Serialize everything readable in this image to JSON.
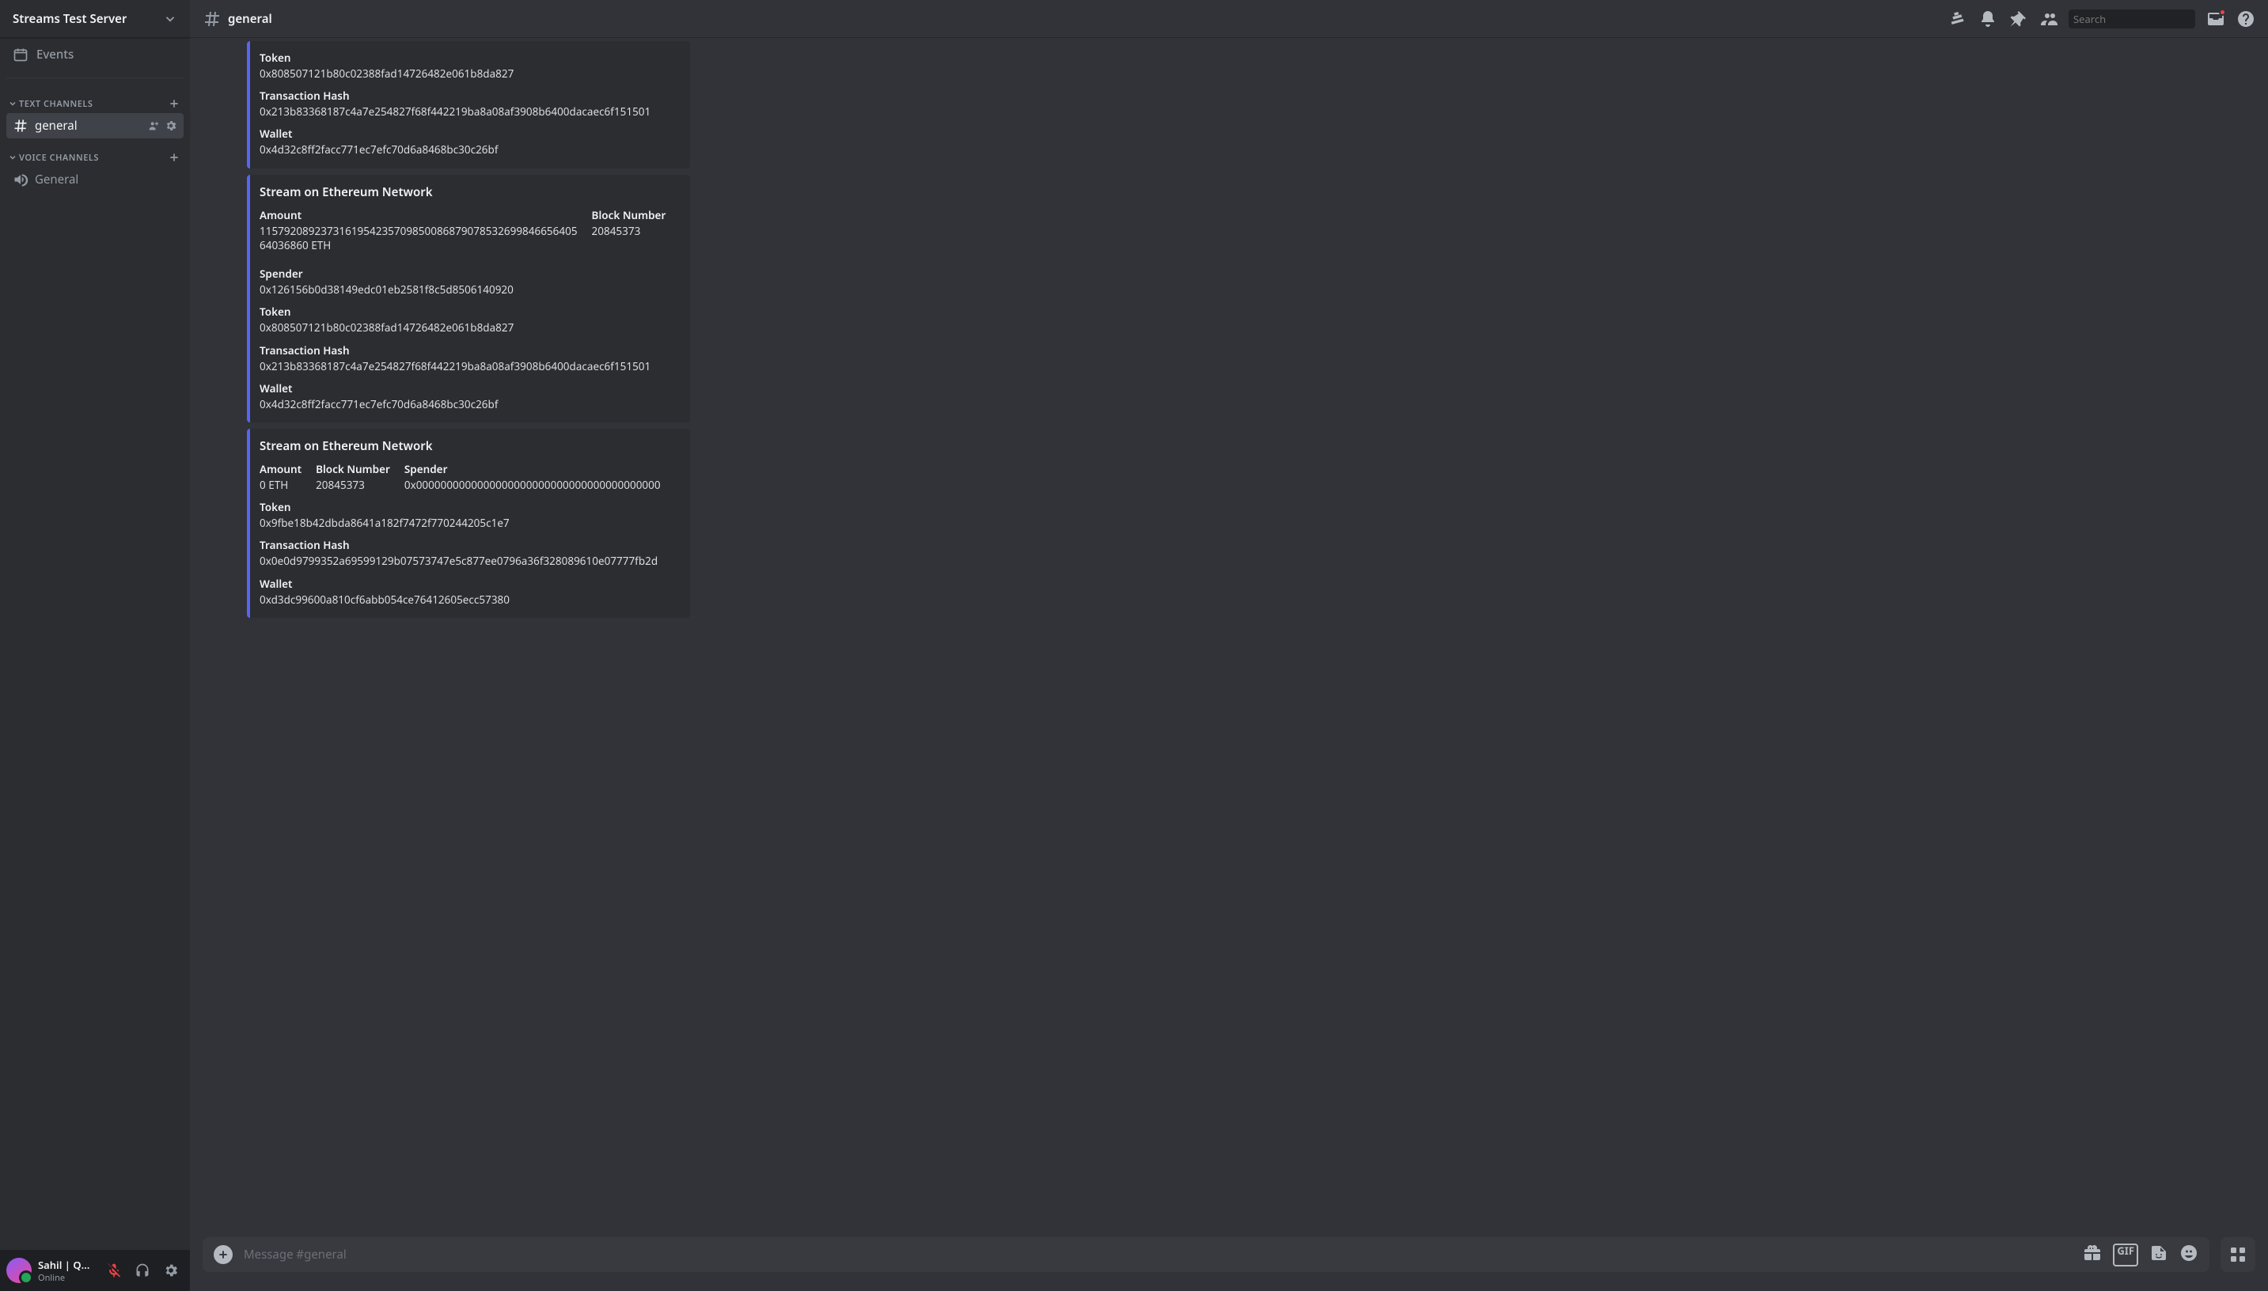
{
  "server": {
    "name": "Streams Test Server"
  },
  "sidebar": {
    "events_label": "Events",
    "text_channels_label": "TEXT CHANNELS",
    "voice_channels_label": "VOICE CHANNELS",
    "text_channels": [
      {
        "name": "general",
        "active": true
      }
    ],
    "voice_channels": [
      {
        "name": "General"
      }
    ]
  },
  "user": {
    "name": "Sahil | Qui...",
    "status": "Online"
  },
  "topbar": {
    "channel_name": "general",
    "search_placeholder": "Search"
  },
  "embeds": [
    {
      "partial": true,
      "fields_full": [
        {
          "name": "Token",
          "value": "0x808507121b80c02388fad14726482e061b8da827"
        },
        {
          "name": "Transaction Hash",
          "value": "0x213b83368187c4a7e254827f68f442219ba8a08af3908b6400dacaec6f151501"
        },
        {
          "name": "Wallet",
          "value": "0x4d32c8ff2facc771ec7efc70d6a8468bc30c26bf"
        }
      ]
    },
    {
      "title": "Stream on Ethereum Network",
      "row_fields": [
        {
          "name": "Amount",
          "value": "1157920892373161954235709850086879078532699846656405\n64036860 ETH"
        },
        {
          "name": "Block Number",
          "value": "20845373"
        },
        {
          "name": "Spender",
          "value": "0x126156b0d38149edc01eb2581f8c5d8506140920"
        }
      ],
      "fields_full": [
        {
          "name": "Token",
          "value": "0x808507121b80c02388fad14726482e061b8da827"
        },
        {
          "name": "Transaction Hash",
          "value": "0x213b83368187c4a7e254827f68f442219ba8a08af3908b6400dacaec6f151501"
        },
        {
          "name": "Wallet",
          "value": "0x4d32c8ff2facc771ec7efc70d6a8468bc30c26bf"
        }
      ]
    },
    {
      "title": "Stream on Ethereum Network",
      "row_fields": [
        {
          "name": "Amount",
          "value": "0 ETH"
        },
        {
          "name": "Block Number",
          "value": "20845373"
        },
        {
          "name": "Spender",
          "value": "0x0000000000000000000000000000000000000000"
        }
      ],
      "fields_full": [
        {
          "name": "Token",
          "value": "0x9fbe18b42dbda8641a182f7472f770244205c1e7"
        },
        {
          "name": "Transaction Hash",
          "value": "0x0e0d9799352a69599129b07573747e5c877ee0796a36f328089610e07777fb2d"
        },
        {
          "name": "Wallet",
          "value": "0xd3dc99600a810cf6abb054ce76412605ecc57380"
        }
      ]
    }
  ],
  "input": {
    "placeholder": "Message #general",
    "gif_label": "GIF"
  }
}
